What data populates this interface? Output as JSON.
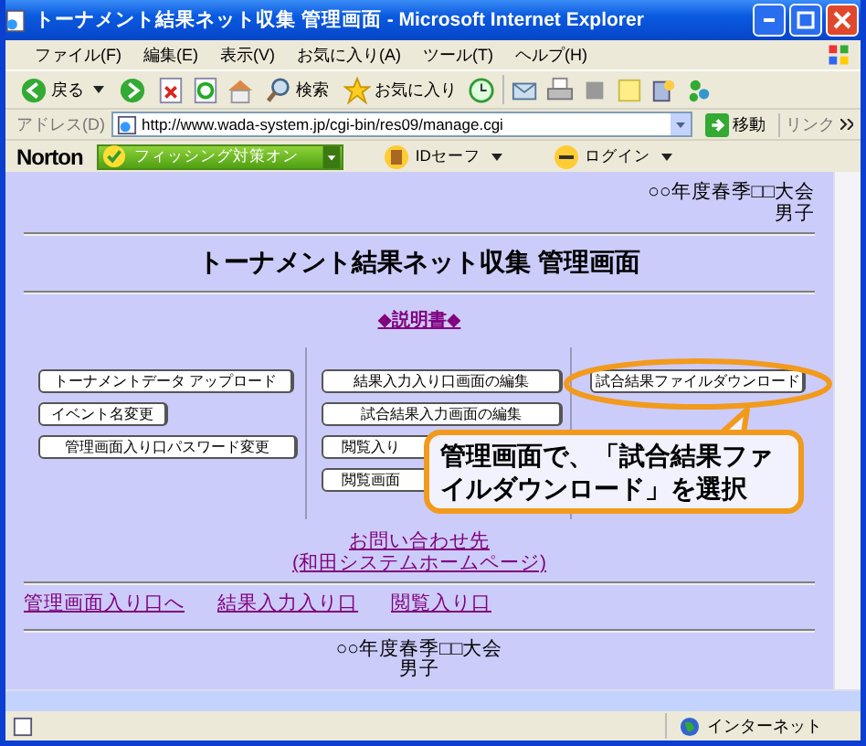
{
  "window": {
    "title": "トーナメント結果ネット収集 管理画面 - Microsoft Internet Explorer"
  },
  "menu": [
    "ファイル(F)",
    "編集(E)",
    "表示(V)",
    "お気に入り(A)",
    "ツール(T)",
    "ヘルプ(H)"
  ],
  "toolbar": {
    "back": "戻る",
    "search": "検索",
    "favorites": "お気に入り"
  },
  "address": {
    "label": "アドレス(D)",
    "url": "http://www.wada-system.jp/cgi-bin/res09/manage.cgi",
    "go": "移動",
    "links": "リンク"
  },
  "norton": {
    "brand": "Norton",
    "phishing": "フィッシング対策オン",
    "id_safe": "IDセーフ",
    "login": "ログイン"
  },
  "page": {
    "header": [
      "○○年度春季□□大会",
      "男子"
    ],
    "title": "トーナメント結果ネット収集 管理画面",
    "manual_link": "◆説明書◆",
    "columns": [
      [
        "トーナメントデータ アップロード",
        "イベント名変更",
        "管理画面入り口パスワード変更"
      ],
      [
        "結果入力入り口画面の編集",
        "試合結果入力画面の編集",
        "閲覧入り",
        "閲覧画面"
      ],
      [
        "試合結果ファイルダウンロード"
      ]
    ],
    "callout": "管理画面で、「試合結果ファイルダウンロード」を選択",
    "contact": [
      "お問い合わせ先",
      "(和田システムホームページ)"
    ],
    "nav": [
      "管理画面入り口へ",
      "結果入力入り口",
      "閲覧入り口"
    ],
    "footer": [
      "○○年度春季□□大会",
      "男子"
    ]
  },
  "status": {
    "zone": "インターネット"
  }
}
